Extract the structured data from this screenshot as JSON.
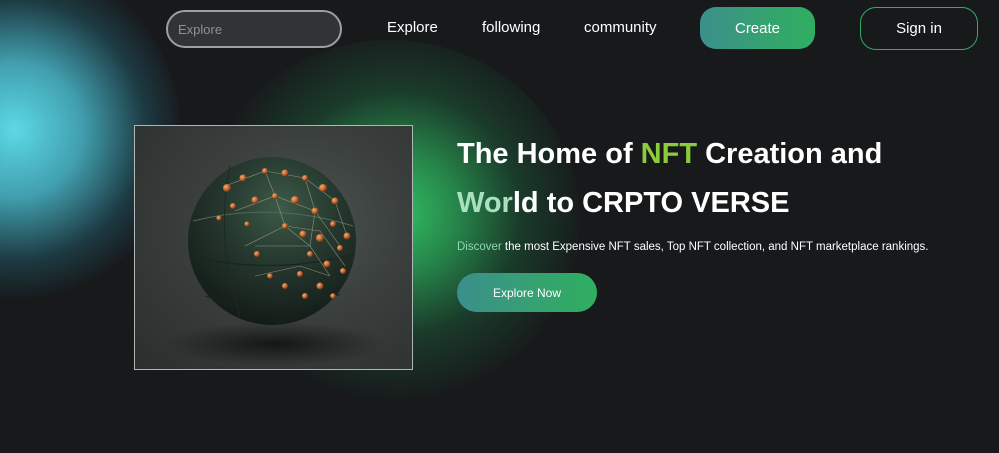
{
  "colors": {
    "background": "#17191b",
    "accent_green": "#2fae62",
    "accent_teal": "#3b8f8c",
    "nft_highlight": "#8ccc3c",
    "glow_cyan": "#60e2f0"
  },
  "nav": {
    "search_placeholder": "Explore",
    "links": [
      "Explore",
      "following",
      "community"
    ],
    "create_label": "Create",
    "signin_label": "Sign in"
  },
  "hero": {
    "image_icon": "nft-globe-image",
    "title_line1_pre": "The Home of ",
    "title_line1_highlight": "NFT",
    "title_line1_post": " Creation and",
    "title_line2_start": "Wor",
    "title_line2_rest": "ld to CRPTO VERSE",
    "desc_start": "Discover",
    "desc_rest": " the most Expensive NFT sales, Top NFT collection, and NFT marketplace rankings.",
    "cta_label": "Explore Now"
  }
}
